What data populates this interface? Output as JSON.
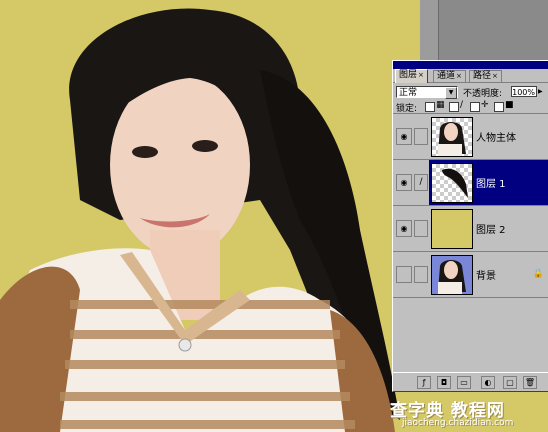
{
  "palette": {
    "tabs": [
      {
        "label": "图层",
        "close": "×"
      },
      {
        "label": "通道",
        "close": "×"
      },
      {
        "label": "路径",
        "close": "×"
      }
    ],
    "blend_mode": "正常",
    "opacity_label": "不透明度:",
    "opacity_value": "100%",
    "lock_label": "锁定:",
    "layers": [
      {
        "name": "人物主体",
        "visible": true,
        "selected": false,
        "locked": false
      },
      {
        "name": "图层 1",
        "visible": true,
        "selected": true,
        "locked": false
      },
      {
        "name": "图层 2",
        "visible": true,
        "selected": false,
        "locked": false
      },
      {
        "name": "背景",
        "visible": false,
        "selected": false,
        "locked": true
      }
    ]
  },
  "colors": {
    "canvas_fill": "#d5c867",
    "selection": "#000080",
    "panel": "#c0c0c0"
  },
  "watermark": {
    "main": "查字典 教程网",
    "url": "jiaocheng.chazidian.com"
  }
}
